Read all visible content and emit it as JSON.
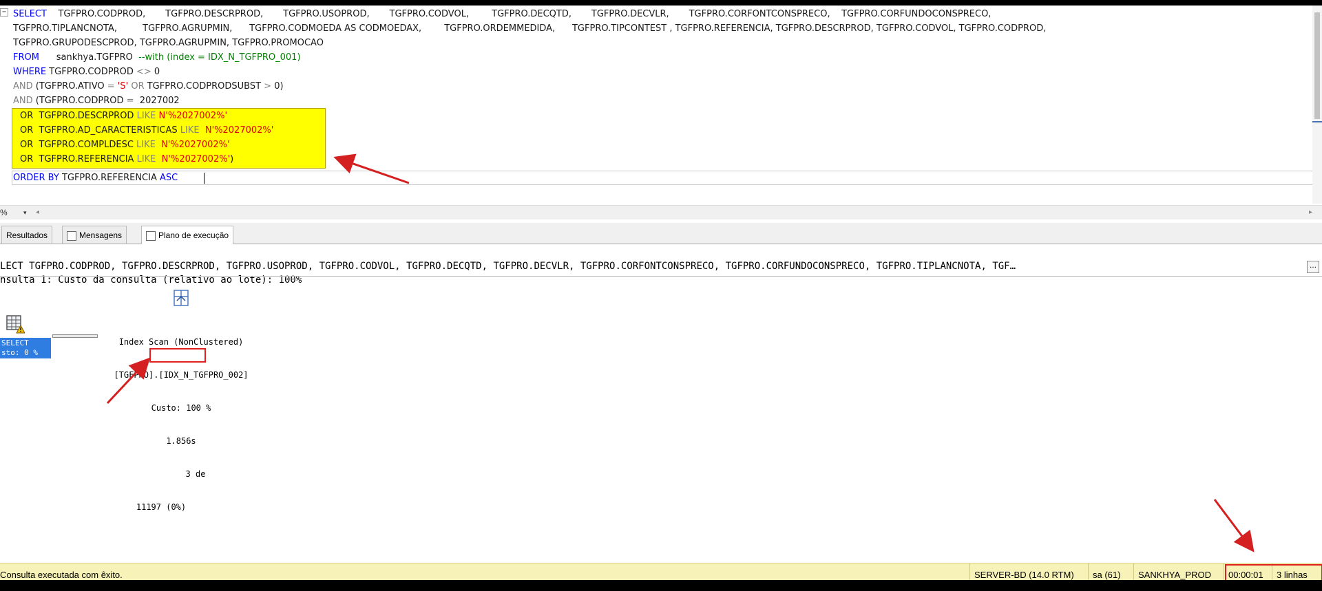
{
  "editor": {
    "lines": [
      [
        {
          "t": "SELECT",
          "c": "kw"
        },
        {
          "t": "    TGFPRO.CODPROD,       TGFPRO.DESCRPROD,       TGFPRO.USOPROD,       TGFPRO.CODVOL,        TGFPRO.DECQTD,       TGFPRO.DECVLR,       TGFPRO.CORFONTCONSPRECO,    TGFPRO.CORFUNDOCONSPRECO,",
          "c": ""
        }
      ],
      [
        {
          "t": "TGFPRO.TIPLANCNOTA,         TGFPRO.AGRUPMIN,      TGFPRO.CODMOEDA AS CODMOEDAX,        TGFPRO.ORDEMMEDIDA,      TGFPRO.TIPCONTEST , TGFPRO.REFERENCIA, TGFPRO.DESCRPROD, TGFPRO.CODVOL, TGFPRO.CODPROD,",
          "c": ""
        }
      ],
      [
        {
          "t": "TGFPRO.GRUPODESCPROD, TGFPRO.AGRUPMIN, TGFPRO.PROMOCAO",
          "c": ""
        }
      ],
      [
        {
          "t": "FROM",
          "c": "kw"
        },
        {
          "t": "      sankhya.TGFPRO  ",
          "c": ""
        },
        {
          "t": "--with (index = IDX_N_TGFPRO_001)",
          "c": "cm"
        }
      ],
      [
        {
          "t": "WHERE",
          "c": "kw"
        },
        {
          "t": " TGFPRO.CODPROD ",
          "c": ""
        },
        {
          "t": "<>",
          "c": "gray"
        },
        {
          "t": " 0",
          "c": ""
        }
      ],
      [
        {
          "t": "AND",
          "c": "gray"
        },
        {
          "t": " (TGFPRO.ATIVO ",
          "c": ""
        },
        {
          "t": "=",
          "c": "gray"
        },
        {
          "t": " ",
          "c": ""
        },
        {
          "t": "'S'",
          "c": "str"
        },
        {
          "t": " OR",
          "c": "gray"
        },
        {
          "t": " TGFPRO.CODPRODSUBST ",
          "c": ""
        },
        {
          "t": ">",
          "c": "gray"
        },
        {
          "t": " 0)",
          "c": ""
        }
      ],
      [
        {
          "t": "AND",
          "c": "gray"
        },
        {
          "t": " (TGFPRO.CODPROD ",
          "c": ""
        },
        {
          "t": "=",
          "c": "gray"
        },
        {
          "t": "  2027002",
          "c": ""
        }
      ]
    ],
    "highlighted_lines": [
      [
        {
          "t": "OR",
          "c": "okw"
        },
        {
          "t": "  TGFPRO.DESCRPROD ",
          "c": ""
        },
        {
          "t": "LIKE",
          "c": "gray"
        },
        {
          "t": " N'%2027002%'",
          "c": "str"
        }
      ],
      [
        {
          "t": "OR",
          "c": "okw"
        },
        {
          "t": "  TGFPRO.AD_CARACTERISTICAS ",
          "c": ""
        },
        {
          "t": "LIKE",
          "c": "gray"
        },
        {
          "t": "  N'%2027002%'",
          "c": "str"
        }
      ],
      [
        {
          "t": "OR",
          "c": "okw"
        },
        {
          "t": "  TGFPRO.COMPLDESC ",
          "c": ""
        },
        {
          "t": "LIKE",
          "c": "gray"
        },
        {
          "t": "  N'%2027002%'",
          "c": "str"
        }
      ],
      [
        {
          "t": "OR",
          "c": "okw"
        },
        {
          "t": "  TGFPRO.REFERENCIA ",
          "c": ""
        },
        {
          "t": "LIKE",
          "c": "gray"
        },
        {
          "t": "  N'%2027002%'",
          "c": "str"
        },
        {
          "t": ")",
          "c": ""
        }
      ]
    ],
    "order_line": [
      {
        "t": "ORDER BY",
        "c": "kw"
      },
      {
        "t": " TGFPRO.REFERENCIA ",
        "c": ""
      },
      {
        "t": "ASC",
        "c": "kw"
      }
    ]
  },
  "zoombar": {
    "zoom": "%",
    "dropdown": "▾",
    "left_arrow": "◂",
    "right_arrow": "▸"
  },
  "tabs": [
    {
      "label": "Resultados"
    },
    {
      "label": "Mensagens"
    },
    {
      "label": "Plano de execução"
    }
  ],
  "plan": {
    "header_line1": "nsulta 1: Custo da consulta (relativo ao lote): 100%",
    "header_line2": "LECT TGFPRO.CODPROD, TGFPRO.DESCRPROD, TGFPRO.USOPROD, TGFPRO.CODVOL, TGFPRO.DECQTD, TGFPRO.DECVLR, TGFPRO.CORFONTCONSPRECO, TGFPRO.CORFUNDOCONSPRECO, TGFPRO.TIPLANCNOTA, TGF…",
    "ellipsis_button": "…",
    "select_node": {
      "line1": "SELECT",
      "line2": "sto: 0 %"
    },
    "index_node": {
      "line1": "Index Scan (NonClustered)",
      "line2": "[TGFPRO].[IDX_N_TGFPRO_002]",
      "line3": "Custo: 100 %",
      "line4": "1.856s",
      "line5": "3 de",
      "line6": "11197 (0%)"
    }
  },
  "status": {
    "message": "Consulta executada com êxito.",
    "server": "SERVER-BD (14.0 RTM)",
    "user": "sa (61)",
    "database": "SANKHYA_PROD",
    "elapsed": "00:00:01",
    "rows": "3 linhas"
  },
  "colors": {
    "highlight": "#ffff00",
    "status_bg": "#f7f3b8",
    "annotation_red": "#e02020",
    "select_blue": "#2f7de0"
  }
}
